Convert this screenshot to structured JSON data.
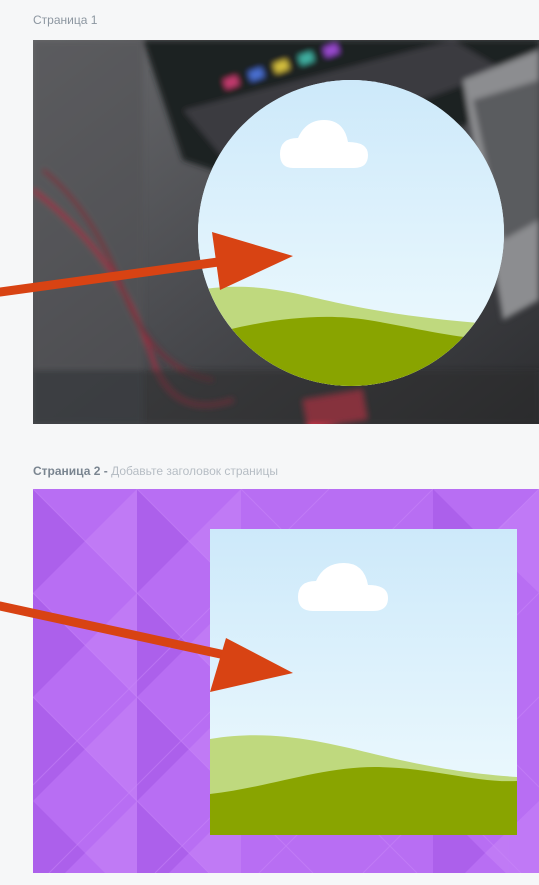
{
  "page1": {
    "label": "Страница 1",
    "element": "circle-image-frame"
  },
  "page2": {
    "label_number": "Страница 2",
    "label_separator": " - ",
    "label_placeholder": "Добавьте заголовок страницы",
    "element": "square-image-frame"
  },
  "colors": {
    "arrow": "#d84313",
    "sky_top": "#cde9fa",
    "sky_bottom": "#f0fbfe",
    "hill_light": "#bfd97e",
    "hill_dark": "#89a400",
    "cloud": "#ffffff",
    "purple_bg": "#b86ef3",
    "page_bg": "#f6f7f8"
  },
  "icons": [
    "cloud-icon",
    "arrow-icon"
  ]
}
